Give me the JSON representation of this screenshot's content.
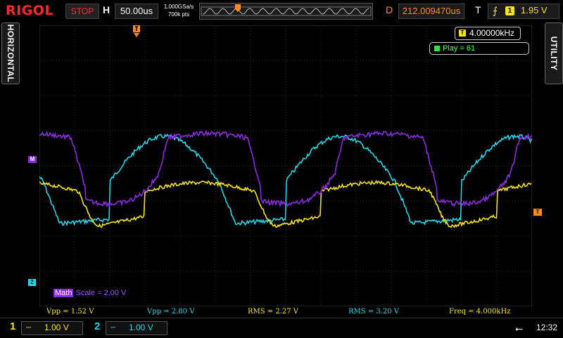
{
  "brand": "RIGOL",
  "top": {
    "run_status": "STOP",
    "h_label": "H",
    "timebase": "50.00us",
    "sample_rate": "1.000GSa/s",
    "mem_depth": "700k pts",
    "d_label": "D",
    "delay": "212.009470us",
    "t_label": "T",
    "trigger_source": "1",
    "trigger_level": "1.95 V"
  },
  "side": {
    "left_tab": "HORIZONTAL",
    "right_tab": "UTILITY"
  },
  "markers": {
    "math": "M",
    "ch2": "2",
    "trigger": "T"
  },
  "screen": {
    "freq_icon": "T",
    "freq_value": "4.00000kHz",
    "play_text": "Play = 61",
    "math_tag": "Math",
    "math_scale": "Scale = 2.00 V"
  },
  "colors": {
    "ch1": "#f7e21a",
    "ch2": "#26d4e8",
    "math": "#8a2be2",
    "trigger": "#ff8c1a",
    "grid": "#3a3a3a"
  },
  "measurements": [
    {
      "text": "Vpp = 1.52 V",
      "channel": "ch1"
    },
    {
      "text": "Vpp = 2.80 V",
      "channel": "ch2"
    },
    {
      "text": "RMS = 2.27 V",
      "channel": "ch1"
    },
    {
      "text": "RMS = 3.20 V",
      "channel": "ch2"
    },
    {
      "text": "Freq = 4.000kHz",
      "channel": "ch1"
    }
  ],
  "channels": [
    {
      "num": "1",
      "coupling": "DC",
      "scale": "1.00 V"
    },
    {
      "num": "2",
      "coupling": "DC",
      "scale": "1.00 V"
    }
  ],
  "clock": "12:32"
}
